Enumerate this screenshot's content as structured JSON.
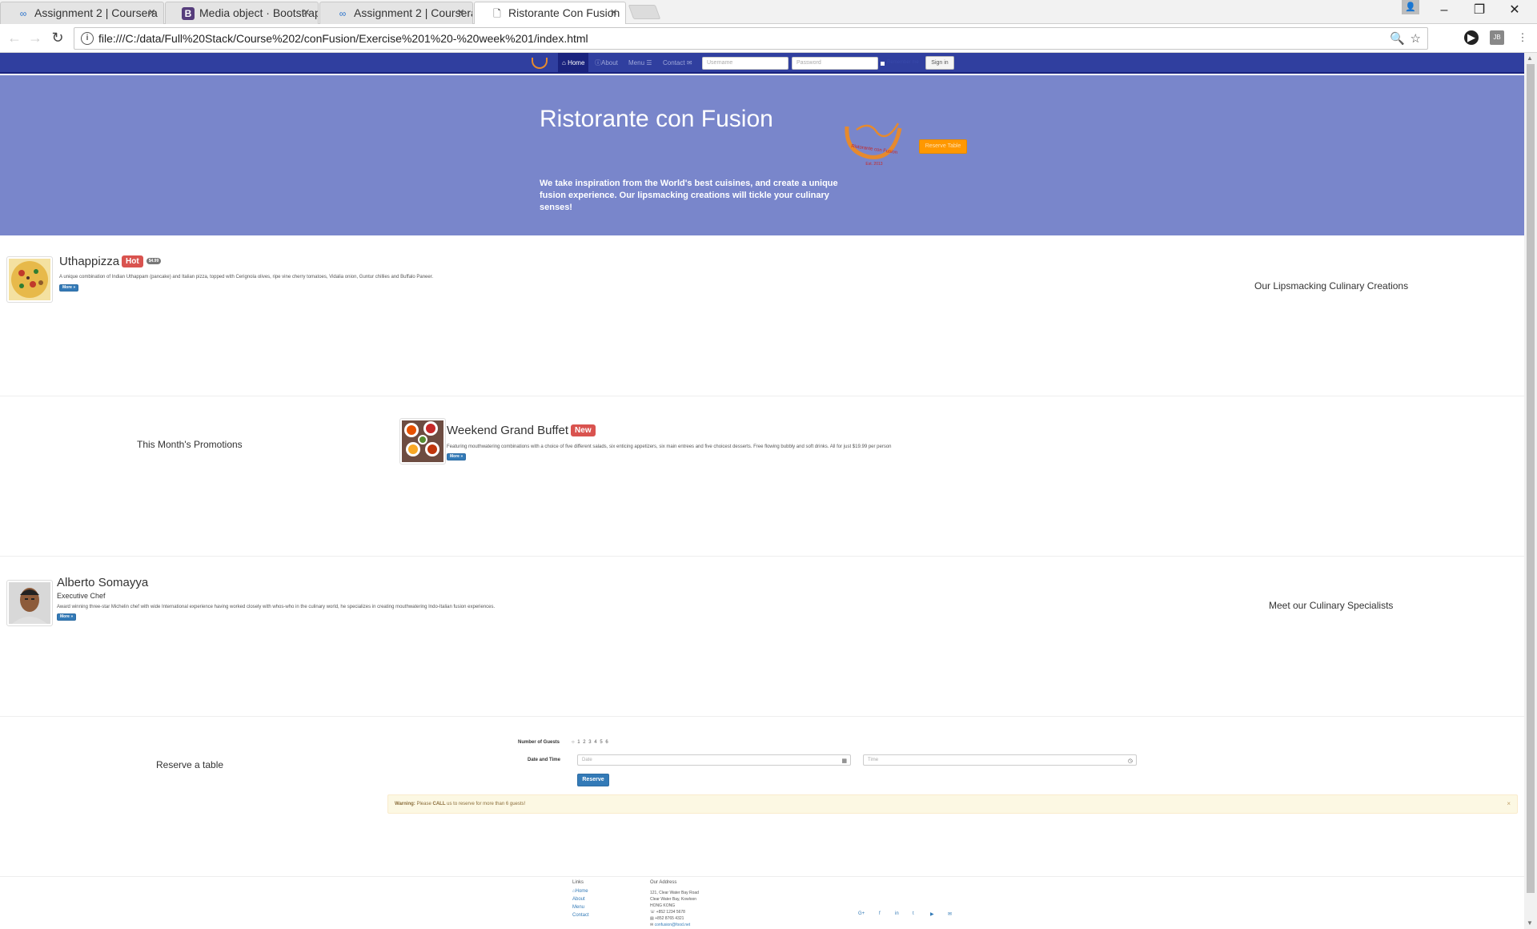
{
  "browser": {
    "tabs": [
      {
        "title": "Assignment 2 | Coursera",
        "icon": "coursera-icon"
      },
      {
        "title": "Media object · Bootstrap",
        "icon": "bootstrap-icon"
      },
      {
        "title": "Assignment 2 | Coursera",
        "icon": "coursera-icon"
      },
      {
        "title": "Ristorante Con Fusion",
        "icon": "page-icon"
      }
    ],
    "url": "file:///C:/data/Full%20Stack/Course%202/conFusion/Exercise%201%20-%20week%201/index.html"
  },
  "nav": {
    "items": [
      "Home",
      "About",
      "Menu",
      "Contact"
    ],
    "username_placeholder": "Username",
    "password_placeholder": "Password",
    "remember": "Remember me",
    "signin": "Sign in"
  },
  "jumbotron": {
    "title": "Ristorante con Fusion",
    "text": "We take inspiration from the World's best cuisines, and create a unique fusion experience. Our lipsmacking creations will tickle your culinary senses!",
    "logo_text": "Ristorante con Fusion",
    "logo_est": "Est. 2013",
    "reserve": "Reserve Table"
  },
  "dish": {
    "title": "Uthappizza",
    "label": "Hot",
    "price": "$4.99",
    "text": "A unique combination of Indian Uthappam (pancake) and Italian pizza, topped with Cerignola olives, ripe vine cherry tomatoes, Vidalia onion, Guntur chillies and Buffalo Paneer.",
    "more": "More »",
    "side": "Our Lipsmacking Culinary Creations"
  },
  "promo": {
    "side": "This Month's Promotions",
    "title": "Weekend Grand Buffet",
    "label": "New",
    "text": "Featuring mouthwatering combinations with a choice of five different salads, six enticing appetizers, six main entrees and five choicest desserts. Free flowing bubbly and soft drinks. All for just $19.99 per person",
    "more": "More »"
  },
  "leader": {
    "name": "Alberto Somayya",
    "role": "Executive Chef",
    "text": "Award winning three-star Michelin chef with wide International experience having worked closely with whos-who in the culinary world, he specializes in creating mouthwatering Indo-Italian fusion experiences.",
    "more": "More »",
    "side": "Meet our Culinary Specialists"
  },
  "reserve": {
    "side": "Reserve a table",
    "guests_label": "Number of Guests",
    "guests_options": "1  2  3  4  5  6",
    "datetime_label": "Date and Time",
    "date_placeholder": "Date",
    "time_placeholder": "Time",
    "button": "Reserve",
    "warning_strong": "Warning:",
    "warning_text": "Please",
    "warning_call": "CALL",
    "warning_rest": "us to reserve for more than 6 guests!"
  },
  "footer": {
    "links_title": "Links",
    "links": [
      "Home",
      "About",
      "Menu",
      "Contact"
    ],
    "address_title": "Our Address",
    "address": [
      "121, Clear Water Bay Road",
      "Clear Water Bay, Kowloon",
      "HONG KONG",
      "+852 1234 5678",
      "+852 8765 4321",
      "confusion@food.net"
    ]
  }
}
